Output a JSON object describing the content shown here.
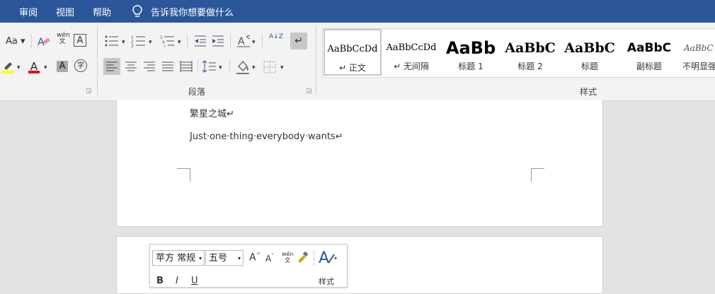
{
  "menu": {
    "review": "审阅",
    "view": "视图",
    "help": "帮助",
    "tell_me": "告诉我你想要做什么"
  },
  "ribbon": {
    "font_partial": {
      "change_case": "Aa",
      "phonetic_guide": "wén\n文",
      "char_border": "A",
      "font_color": "A",
      "char_shading": "A",
      "enclose_char": "字"
    },
    "paragraph": {
      "label": "段落",
      "sort": "A↓Z",
      "show_marks": "↵"
    },
    "styles": {
      "label": "样式",
      "items": [
        {
          "preview": "AaBbCcDd",
          "name": "↵ 正文"
        },
        {
          "preview": "AaBbCcDd",
          "name": "↵ 无间隔"
        },
        {
          "preview": "AaBb",
          "name": "标题 1"
        },
        {
          "preview": "AaBbC",
          "name": "标题 2"
        },
        {
          "preview": "AaBbC",
          "name": "标题"
        },
        {
          "preview": "AaBbC",
          "name": "副标题"
        },
        {
          "preview": "AaBbC",
          "name": "不明显强"
        }
      ]
    }
  },
  "document": {
    "line1": "繁星之城↵",
    "line2": "Just·one·thing·everybody·wants↵"
  },
  "mini_toolbar": {
    "font": "苹方 常规",
    "size": "五号",
    "grow": "A",
    "shrink": "A",
    "phonetic": "wén\n文",
    "styles_label": "样式",
    "bold": "B",
    "italic": "I",
    "underline": "U"
  },
  "colors": {
    "title_bar": "#2b579a",
    "font_color_red": "#e81123",
    "highlight_yellow": "#ffff00"
  }
}
